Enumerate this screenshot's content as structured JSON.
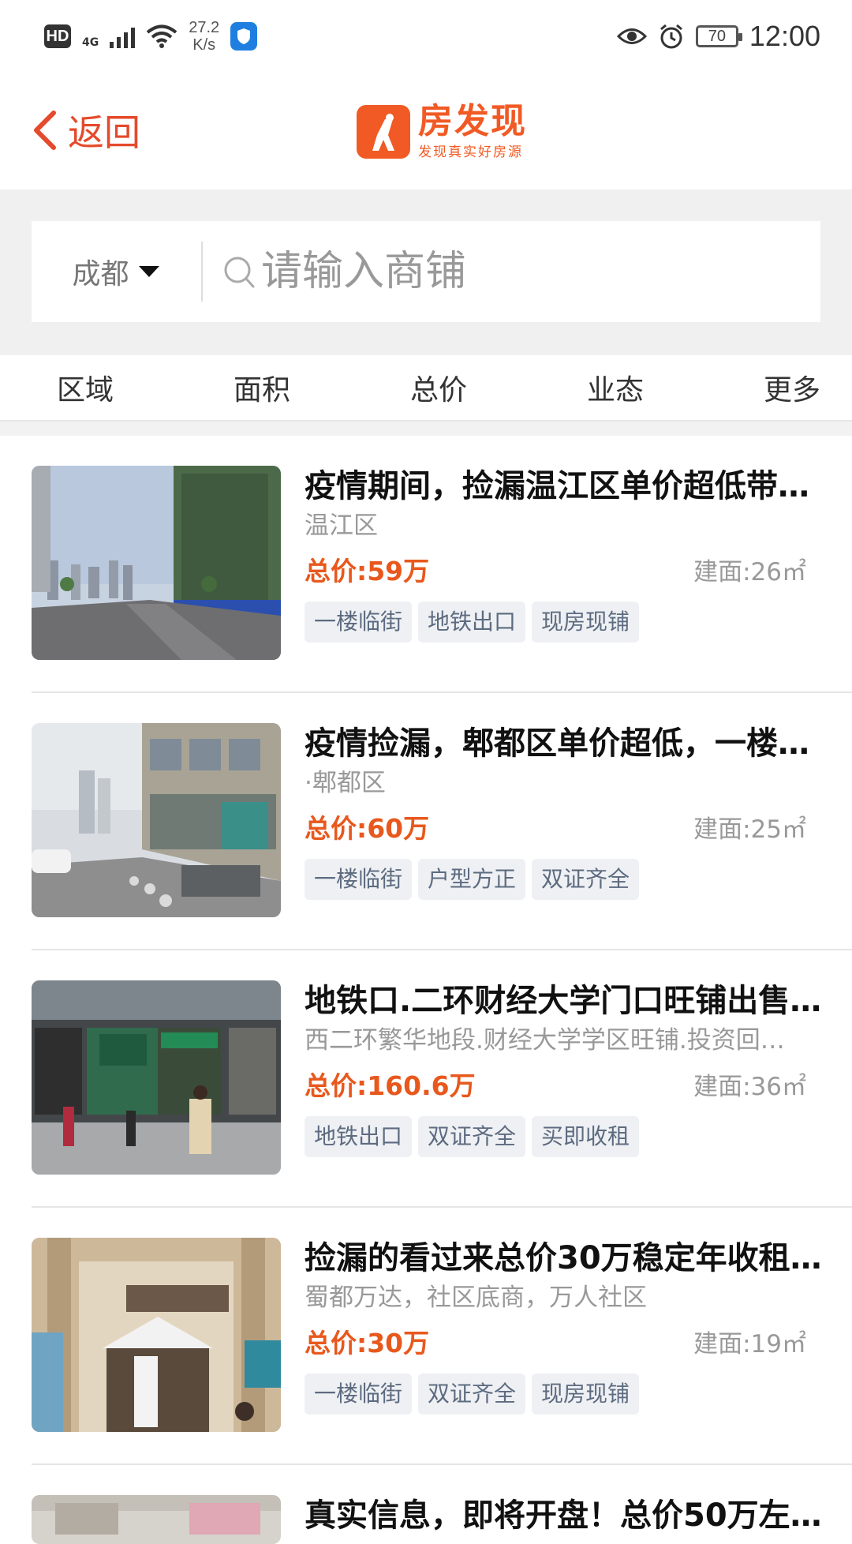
{
  "status_bar": {
    "hd": "HD",
    "network": "4G",
    "speed_value": "27.2",
    "speed_unit": "K/s",
    "battery": "70",
    "time": "12:00"
  },
  "header": {
    "back_label": "返回",
    "logo_title": "房发现",
    "logo_slogan": "发现真实好房源",
    "brand_color": "#f15a24"
  },
  "search": {
    "city": "成都",
    "placeholder": "请输入商铺"
  },
  "filters": [
    "区域",
    "面积",
    "总价",
    "业态",
    "更多"
  ],
  "listings": [
    {
      "title": "疫情期间，捡漏温江区单价超低带…",
      "subtitle": "温江区",
      "price": "总价:59万",
      "area": "建面:26㎡",
      "tags": [
        "一楼临街",
        "地铁出口",
        "现房现铺"
      ]
    },
    {
      "title": "疫情捡漏，郫都区单价超低，一楼…",
      "subtitle": "·郫都区",
      "price": "总价:60万",
      "area": "建面:25㎡",
      "tags": [
        "一楼临街",
        "户型方正",
        "双证齐全"
      ]
    },
    {
      "title": "地铁口.二环财经大学门口旺铺出售…",
      "subtitle": "西二环繁华地段.财经大学学区旺铺.投资回…",
      "price": "总价:160.6万",
      "area": "建面:36㎡",
      "tags": [
        "地铁出口",
        "双证齐全",
        "买即收租"
      ]
    },
    {
      "title": "捡漏的看过来总价30万稳定年收租…",
      "subtitle": "蜀都万达，社区底商，万人社区",
      "price": "总价:30万",
      "area": "建面:19㎡",
      "tags": [
        "一楼临街",
        "双证齐全",
        "现房现铺"
      ]
    },
    {
      "title": "真实信息，即将开盘！总价50万左…"
    }
  ],
  "colors": {
    "accent": "#e8581d",
    "back": "#e44a2b",
    "tag_bg": "#eef0f3",
    "tag_text": "#5d6b80"
  }
}
